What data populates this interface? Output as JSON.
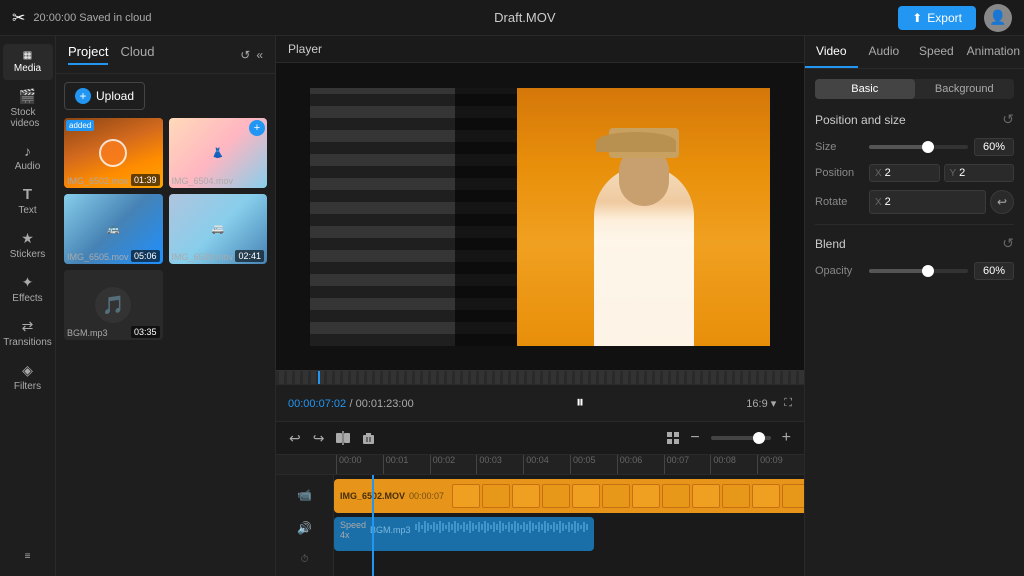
{
  "topbar": {
    "logo": "✂",
    "saved_status": "20:00:00 Saved in cloud",
    "title": "Draft.MOV",
    "export_label": "Export"
  },
  "sidebar": {
    "items": [
      {
        "id": "media",
        "label": "Media",
        "icon": "▦"
      },
      {
        "id": "stock-videos",
        "label": "Stock videos",
        "icon": "🎬"
      },
      {
        "id": "audio",
        "label": "Audio",
        "icon": "♪"
      },
      {
        "id": "text",
        "label": "Text",
        "icon": "T"
      },
      {
        "id": "stickers",
        "label": "Stickers",
        "icon": "★"
      },
      {
        "id": "effects",
        "label": "Effects",
        "icon": "✦"
      },
      {
        "id": "transitions",
        "label": "Transitions",
        "icon": "⇄"
      },
      {
        "id": "filters",
        "label": "Filters",
        "icon": "◈"
      }
    ]
  },
  "panel": {
    "tabs": [
      "Project",
      "Cloud"
    ],
    "active_tab": "Project",
    "upload_label": "Upload",
    "collapse_icon": "«",
    "refresh_icon": "↺",
    "media_items": [
      {
        "id": "img_6502",
        "name": "IMG_6502.mov",
        "duration": "01:39",
        "added": true,
        "type": "video"
      },
      {
        "id": "img_6504",
        "name": "IMG_6504.mov",
        "duration": "",
        "added": false,
        "type": "video"
      },
      {
        "id": "img_6505",
        "name": "IMG_6505.mov",
        "duration": "05:06",
        "added": false,
        "type": "video"
      },
      {
        "id": "img_6509",
        "name": "IMG_6509.mov",
        "duration": "02:41",
        "added": false,
        "type": "video"
      },
      {
        "id": "bgm",
        "name": "BGM.mp3",
        "duration": "03:35",
        "added": false,
        "type": "audio"
      }
    ]
  },
  "player": {
    "header": "Player",
    "current_time": "00:00:07:02",
    "total_time": "00:01:23:00",
    "aspect_ratio": "16:9 ▾",
    "fullscreen_icon": "⛶"
  },
  "timeline": {
    "ruler_marks": [
      "00:00",
      "00:01",
      "00:02",
      "00:03",
      "00:04",
      "00:05",
      "00:06",
      "00:07",
      "00:08",
      "00:09"
    ],
    "video_track": {
      "clip_name": "IMG_6502.MOV",
      "clip_time": "00:00:07"
    },
    "audio_track": {
      "speed_label": "Speed 4x",
      "clip_name": "BGM.mp3"
    },
    "toolbar": {
      "undo": "↩",
      "redo": "↪",
      "split": "⊕",
      "delete": "🗑",
      "grid_icon": "⊞",
      "zoom_out": "−",
      "zoom_in": "+"
    }
  },
  "right_panel": {
    "tabs": [
      "Video",
      "Audio",
      "Speed",
      "Animation"
    ],
    "active_tab": "Video",
    "subtabs": [
      "Basic",
      "Background"
    ],
    "active_subtab": "Basic",
    "sections": {
      "position_size": {
        "title": "Position and size",
        "size_label": "Size",
        "size_value": "60%",
        "size_slider_pct": 60,
        "position_label": "Position",
        "pos_x_label": "X",
        "pos_x_value": "2",
        "pos_y_label": "Y",
        "pos_y_value": "2",
        "rotate_label": "Rotate",
        "rot_x_label": "X",
        "rot_x_value": "2"
      },
      "blend": {
        "title": "Blend",
        "opacity_label": "Opacity",
        "opacity_value": "60%",
        "opacity_slider_pct": 60
      }
    }
  }
}
